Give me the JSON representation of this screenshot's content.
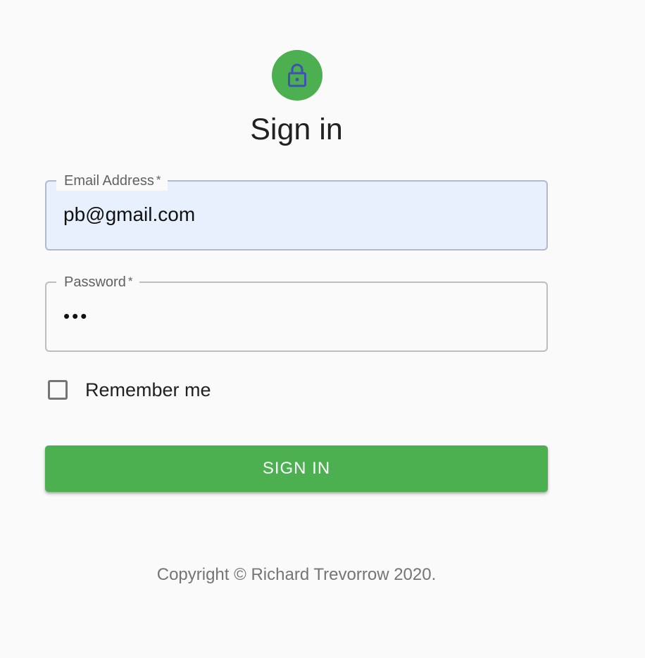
{
  "header": {
    "avatar_icon": "lock-icon",
    "title": "Sign in"
  },
  "form": {
    "email": {
      "label": "Email Address",
      "required_mark": "*",
      "value": "pb@gmail.com"
    },
    "password": {
      "label": "Password",
      "required_mark": "*",
      "value": "•••"
    },
    "remember": {
      "label": "Remember me",
      "checked": false
    },
    "submit_label": "SIGN IN"
  },
  "footer": {
    "copyright": "Copyright © Richard Trevorrow 2020."
  },
  "colors": {
    "accent": "#4caf50",
    "icon": "#3f51b5",
    "autofill_background": "#e8f0fe"
  }
}
